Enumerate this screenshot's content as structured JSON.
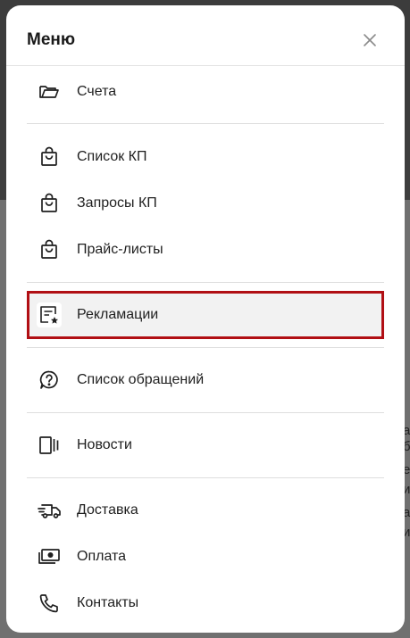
{
  "menu": {
    "title": "Меню",
    "items": [
      {
        "label": "Счета",
        "icon": "folder-icon"
      },
      {
        "label": "Список КП",
        "icon": "shopping-bag-icon"
      },
      {
        "label": "Запросы КП",
        "icon": "shopping-bag-icon"
      },
      {
        "label": "Прайс-листы",
        "icon": "shopping-bag-icon"
      },
      {
        "label": "Рекламации",
        "icon": "document-star-icon",
        "active": true
      },
      {
        "label": "Список обращений",
        "icon": "question-bubble-icon"
      },
      {
        "label": "Новости",
        "icon": "news-cards-icon"
      },
      {
        "label": "Доставка",
        "icon": "delivery-truck-icon"
      },
      {
        "label": "Оплата",
        "icon": "money-bill-icon"
      },
      {
        "label": "Контакты",
        "icon": "phone-icon"
      }
    ]
  },
  "background": {
    "fragments": [
      "а",
      "б",
      "е",
      "и",
      "а",
      "и"
    ]
  },
  "colors": {
    "active_border": "#b10f14",
    "active_background": "#f2f2f2"
  }
}
